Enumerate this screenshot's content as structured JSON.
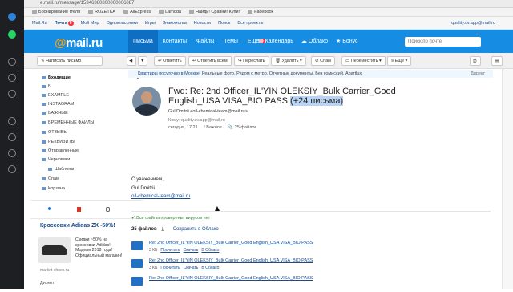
{
  "browser": {
    "url": "e.mail.ru/message/15346880800000006887"
  },
  "bookmarks": [
    "Бронирование гтеля",
    "ROZETKA",
    "AliExpress",
    "Lamoda",
    "Найди! Сравни! Купи!",
    "Facebook"
  ],
  "portal_nav": {
    "items": [
      "Mail.Ru",
      "Почта",
      "Мой Мир",
      "Одноклассники",
      "Игры",
      "Знакомства",
      "Новости",
      "Поиск",
      "Все проекты"
    ],
    "mail_badge": "6",
    "account": "quality.cv.app@mail.ru"
  },
  "header": {
    "logo_at": "@",
    "logo_text": "mail.ru",
    "tabs": [
      "Письма",
      "Контакты",
      "Файлы",
      "Темы",
      "Ещё"
    ],
    "more_badge": "6",
    "services": [
      "Календарь",
      "Облако",
      "Бонус"
    ],
    "search_placeholder": "Поиск по почте"
  },
  "toolbar": {
    "compose": "Написать письмо",
    "reply": "Ответить",
    "reply_all": "Ответить всем",
    "forward": "Переслать",
    "delete": "Удалить",
    "spam": "Спам",
    "move": "Переместить",
    "more": "Ещё"
  },
  "sidebar": {
    "folders": [
      {
        "label": "Входящие",
        "count": "2"
      },
      {
        "label": "В",
        "count": ""
      },
      {
        "label": "EXAMPLE",
        "count": ""
      },
      {
        "label": "INSTAGRAM",
        "count": ""
      },
      {
        "label": "ВАЖНЫЕ",
        "count": ""
      },
      {
        "label": "ВРЕМЕННЫЕ ФАЙЛЫ",
        "count": ""
      },
      {
        "label": "ОТЗЫВЫ",
        "count": ""
      },
      {
        "label": "РЕКВИЗИТЫ",
        "count": ""
      },
      {
        "label": "Отправленные",
        "count": ""
      },
      {
        "label": "Черновики",
        "count": ""
      },
      {
        "label": "Шаблоны",
        "count": ""
      },
      {
        "label": "Спам",
        "count": ""
      },
      {
        "label": "Корзина",
        "count": ""
      }
    ]
  },
  "ad": {
    "title": "Кроссовки Adidas ZX -50%!",
    "text": "Скидки ~50% на кроссовки Adidas! Модели 2018 года! Официальный магазин!",
    "site": "market-shoes.ru",
    "direct": "Директ"
  },
  "promo": {
    "text": "Квартиры посуточно в Москве.",
    "rest": "Реальные фото. Рядом с метро. Отчетные документы. Без комиссий. Apartlux.",
    "label": "Директ"
  },
  "message": {
    "subject": "Fwd: Re: 2nd Officer_IL'YIN OLEKSIY_Bulk Carrier_Good English_USA VISA_BIO PASS",
    "thread_count": "(+24 письма)",
    "from": "Gul Dmitrii <oil-chemical-team@mail.ru>",
    "to": "Кому: quality.cv.app@mail.ru",
    "time": "сегодня, 17:21",
    "important": "Важное",
    "files_count": "25 файлов",
    "body_greeting": "С уважением,",
    "body_name": "Gul Dmitrii",
    "body_email": "oil-chemical-team@mail.ru"
  },
  "attachments_header": {
    "virus_ok": "Все файлы проверены, вирусов нет",
    "count": "25 файлов",
    "save_cloud": "Сохранить в Облако"
  },
  "attachments": [
    {
      "name": "Re: 2nd Officer_IL'YIN OLEKSIY_Bulk Carrier_Good English_USA VISA_BIO PASS",
      "size": "3 КБ",
      "view": "Прочитать",
      "dl": "Скачать",
      "cloud": "В Облако"
    },
    {
      "name": "Re: 2nd Officer_IL'YIN OLEKSIY_Bulk Carrier_Good English_USA VISA_BIO PASS",
      "size": "3 КБ",
      "view": "Прочитать",
      "dl": "Скачать",
      "cloud": "В Облако"
    },
    {
      "name": "Re: 2nd Officer_IL'YIN OLEKSIY_Bulk Carrier_Good English_USA VISA_BIO PASS",
      "size": "",
      "view": "",
      "dl": "",
      "cloud": ""
    }
  ]
}
